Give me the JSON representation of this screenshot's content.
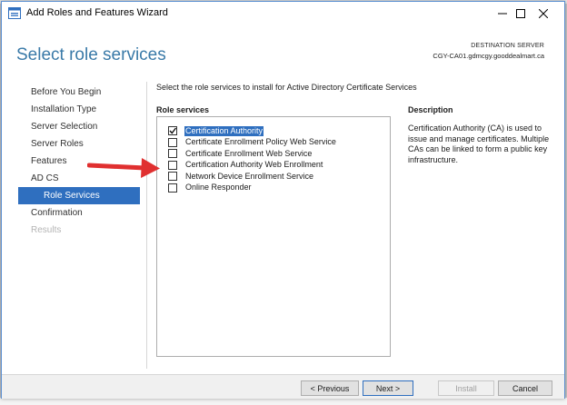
{
  "window": {
    "title": "Add Roles and Features Wizard",
    "controls": {
      "minimize_icon": "minimize-icon",
      "maximize_icon": "maximize-icon",
      "close_icon": "close-icon"
    }
  },
  "header": {
    "page_title": "Select role services",
    "destination_label": "DESTINATION SERVER",
    "destination_server": "CGY-CA01.gdmcgy.gooddealmart.ca"
  },
  "nav": {
    "items": [
      {
        "label": "Before You Begin",
        "state": "normal"
      },
      {
        "label": "Installation Type",
        "state": "normal"
      },
      {
        "label": "Server Selection",
        "state": "normal"
      },
      {
        "label": "Server Roles",
        "state": "normal"
      },
      {
        "label": "Features",
        "state": "normal"
      },
      {
        "label": "AD CS",
        "state": "normal"
      },
      {
        "label": "Role Services",
        "state": "active"
      },
      {
        "label": "Confirmation",
        "state": "normal"
      },
      {
        "label": "Results",
        "state": "disabled"
      }
    ]
  },
  "main": {
    "instruction": "Select the role services to install for Active Directory Certificate Services",
    "role_services_header": "Role services",
    "role_services": [
      {
        "label": "Certification Authority",
        "checked": true,
        "selected": true
      },
      {
        "label": "Certificate Enrollment Policy Web Service",
        "checked": false,
        "selected": false
      },
      {
        "label": "Certificate Enrollment Web Service",
        "checked": false,
        "selected": false
      },
      {
        "label": "Certification Authority Web Enrollment",
        "checked": false,
        "selected": false
      },
      {
        "label": "Network Device Enrollment Service",
        "checked": false,
        "selected": false
      },
      {
        "label": "Online Responder",
        "checked": false,
        "selected": false
      }
    ],
    "description_header": "Description",
    "description_text": "Certification Authority (CA) is used to issue and manage certificates. Multiple CAs can be linked to form a public key infrastructure."
  },
  "annotation": {
    "arrow_color": "#e03030"
  },
  "footer": {
    "previous_label": "< Previous",
    "next_label": "Next >",
    "install_label": "Install",
    "cancel_label": "Cancel"
  },
  "colors": {
    "accent": "#2f6fbf",
    "title": "#3a7aa8"
  }
}
